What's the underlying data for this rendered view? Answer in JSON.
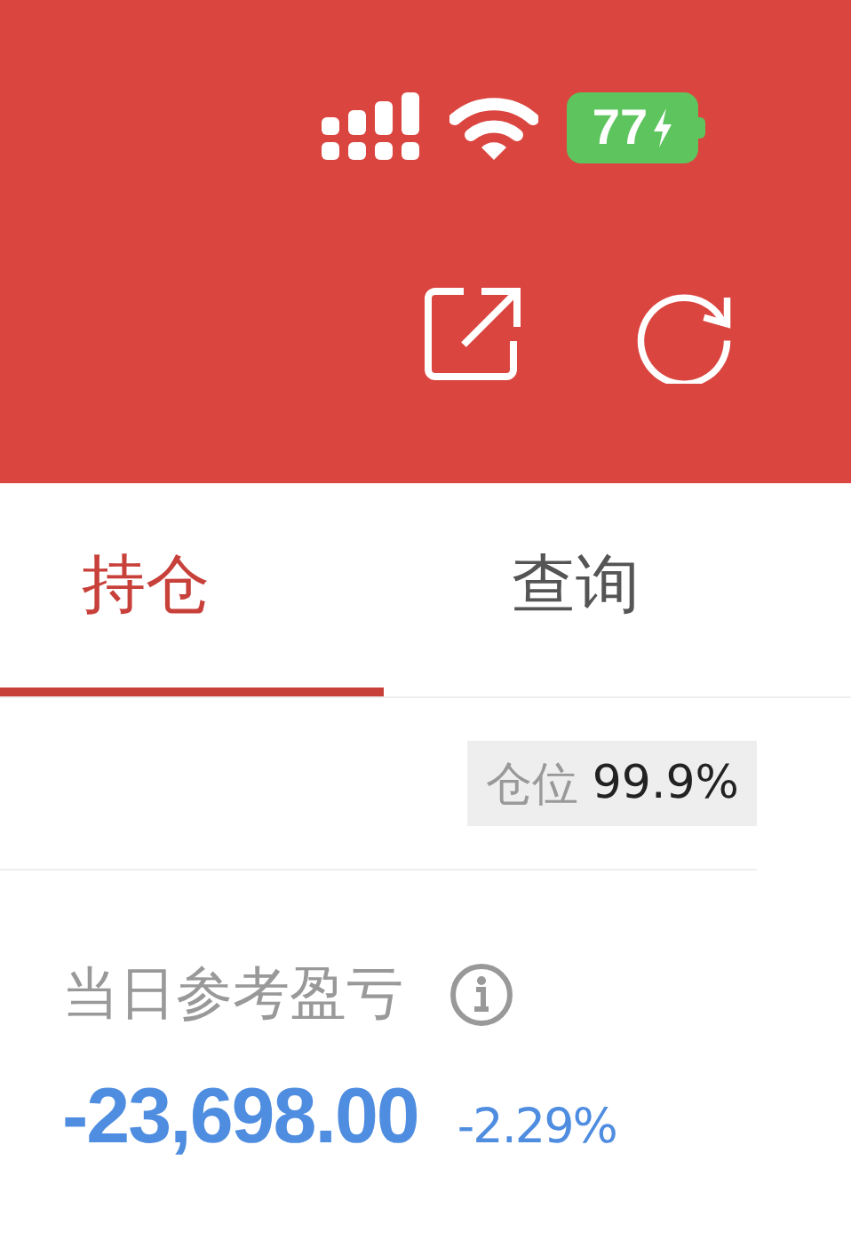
{
  "status_bar": {
    "battery": "77",
    "charging": true
  },
  "tabs": [
    {
      "label": "持仓",
      "selected": true
    },
    {
      "label": "查询",
      "selected": false
    }
  ],
  "position": {
    "label": "仓位",
    "value": "99.9%"
  },
  "pnl": {
    "label": "当日参考盈亏",
    "amount": "-23,698.00",
    "percent": "-2.29%"
  }
}
